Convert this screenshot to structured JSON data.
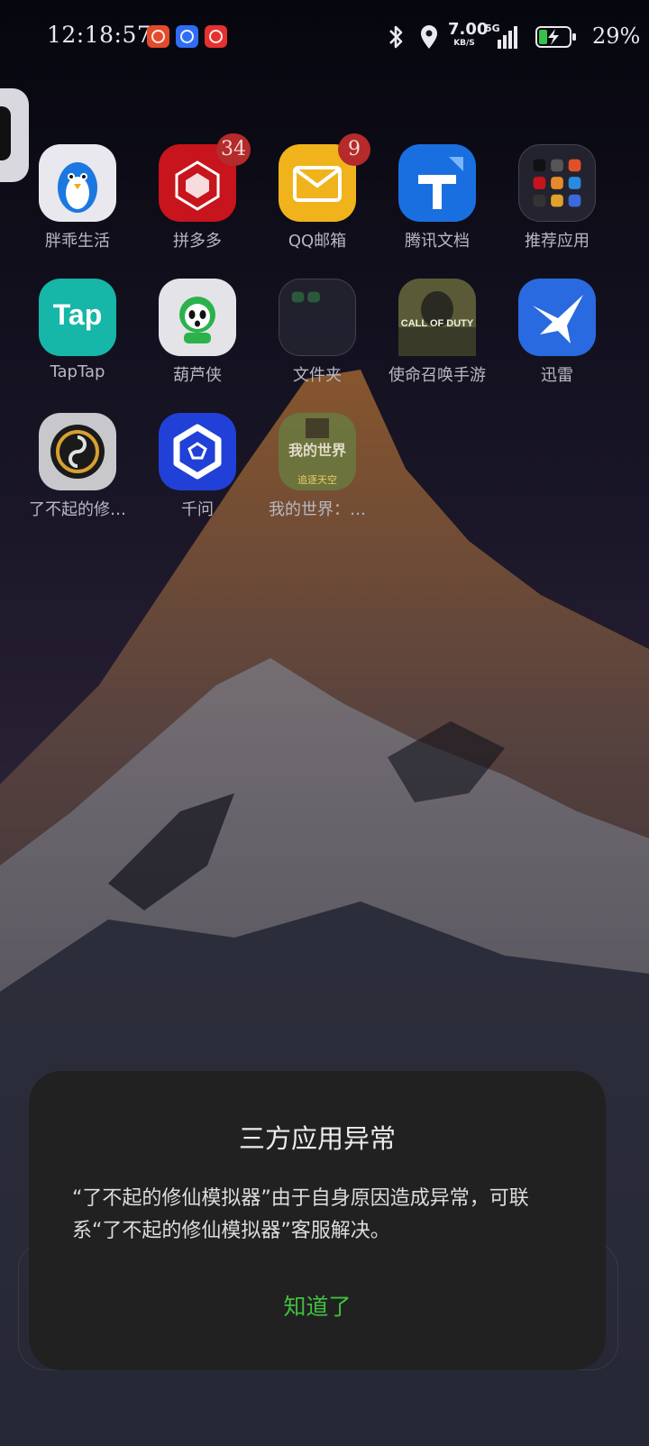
{
  "status_bar": {
    "time": "12:18:57",
    "notification_icons": [
      "app-alert-icon",
      "baidu-icon",
      "music-icon"
    ],
    "net_speed_value": "7.00",
    "net_speed_unit": "KB/S",
    "network_type": "5G",
    "battery_percent": "29%",
    "battery_level": 0.29
  },
  "apps": [
    {
      "label": "胖乖生活",
      "badge": "",
      "icon": "penguin-icon"
    },
    {
      "label": "拼多多",
      "badge": "34",
      "icon": "pinduoduo-icon"
    },
    {
      "label": "QQ邮箱",
      "badge": "9",
      "icon": "mail-icon"
    },
    {
      "label": "腾讯文档",
      "badge": "",
      "icon": "tencent-docs-icon"
    },
    {
      "label": "推荐应用",
      "badge": "",
      "icon": "folder-icon"
    },
    {
      "label": "TapTap",
      "badge": "",
      "icon": "taptap-icon",
      "icon_text": "Tap"
    },
    {
      "label": "葫芦侠",
      "badge": "",
      "icon": "huluxia-icon"
    },
    {
      "label": "文件夹",
      "badge": "",
      "icon": "folder-icon"
    },
    {
      "label": "使命召唤手游",
      "badge": "",
      "icon": "call-of-duty-icon",
      "icon_text": "CALL OF DUTY"
    },
    {
      "label": "迅雷",
      "badge": "",
      "icon": "xunlei-bird-icon"
    },
    {
      "label": "了不起的修…",
      "badge": "",
      "icon": "taiji-icon"
    },
    {
      "label": "千问",
      "badge": "",
      "icon": "qianwen-icon"
    },
    {
      "label": "我的世界：…",
      "badge": "",
      "icon": "minecraft-icon",
      "icon_text": "我的世界",
      "icon_subtext": "追逐天空"
    }
  ],
  "dialog": {
    "title": "三方应用异常",
    "message": "“了不起的修仙模拟器”由于自身原因造成异常，可联系“了不起的修仙模拟器”客服解决。",
    "button": "知道了"
  },
  "colors": {
    "accent_green": "#3fbf3f",
    "dialog_bg": "#212121",
    "badge_red": "#b52a2a"
  }
}
